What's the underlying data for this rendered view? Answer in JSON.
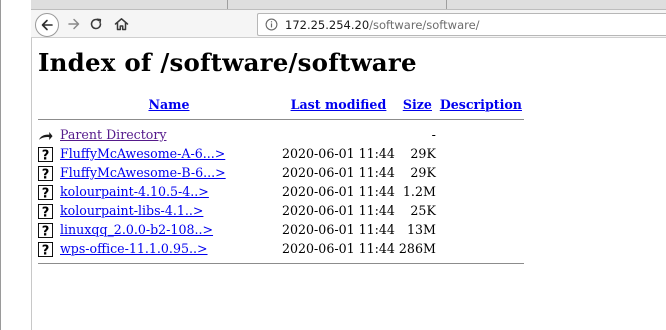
{
  "browser": {
    "url_host": "172.25.254.20",
    "url_path": "/software/software/"
  },
  "page": {
    "title": "Index of /software/software",
    "columns": {
      "name": "Name",
      "last_modified": "Last modified",
      "size": "Size",
      "description": "Description"
    },
    "parent": {
      "label": "Parent Directory",
      "size": "-",
      "icon": "back-arrow-icon"
    },
    "rows": [
      {
        "name": "FluffyMcAwesome-A-6...>",
        "modified": "2020-06-01 11:44",
        "size": "29K",
        "icon": "unknown-file-icon"
      },
      {
        "name": "FluffyMcAwesome-B-6...>",
        "modified": "2020-06-01 11:44",
        "size": "29K",
        "icon": "unknown-file-icon"
      },
      {
        "name": "kolourpaint-4.10.5-4..>",
        "modified": "2020-06-01 11:44",
        "size": "1.2M",
        "icon": "unknown-file-icon"
      },
      {
        "name": "kolourpaint-libs-4.1..>",
        "modified": "2020-06-01 11:44",
        "size": "25K",
        "icon": "unknown-file-icon"
      },
      {
        "name": "linuxqq_2.0.0-b2-108..>",
        "modified": "2020-06-01 11:44",
        "size": "13M",
        "icon": "unknown-file-icon"
      },
      {
        "name": "wps-office-11.1.0.95..>",
        "modified": "2020-06-01 11:44",
        "size": "286M",
        "icon": "unknown-file-icon"
      }
    ]
  },
  "colors": {
    "link": "#0000ee",
    "visited": "#551a8b"
  }
}
